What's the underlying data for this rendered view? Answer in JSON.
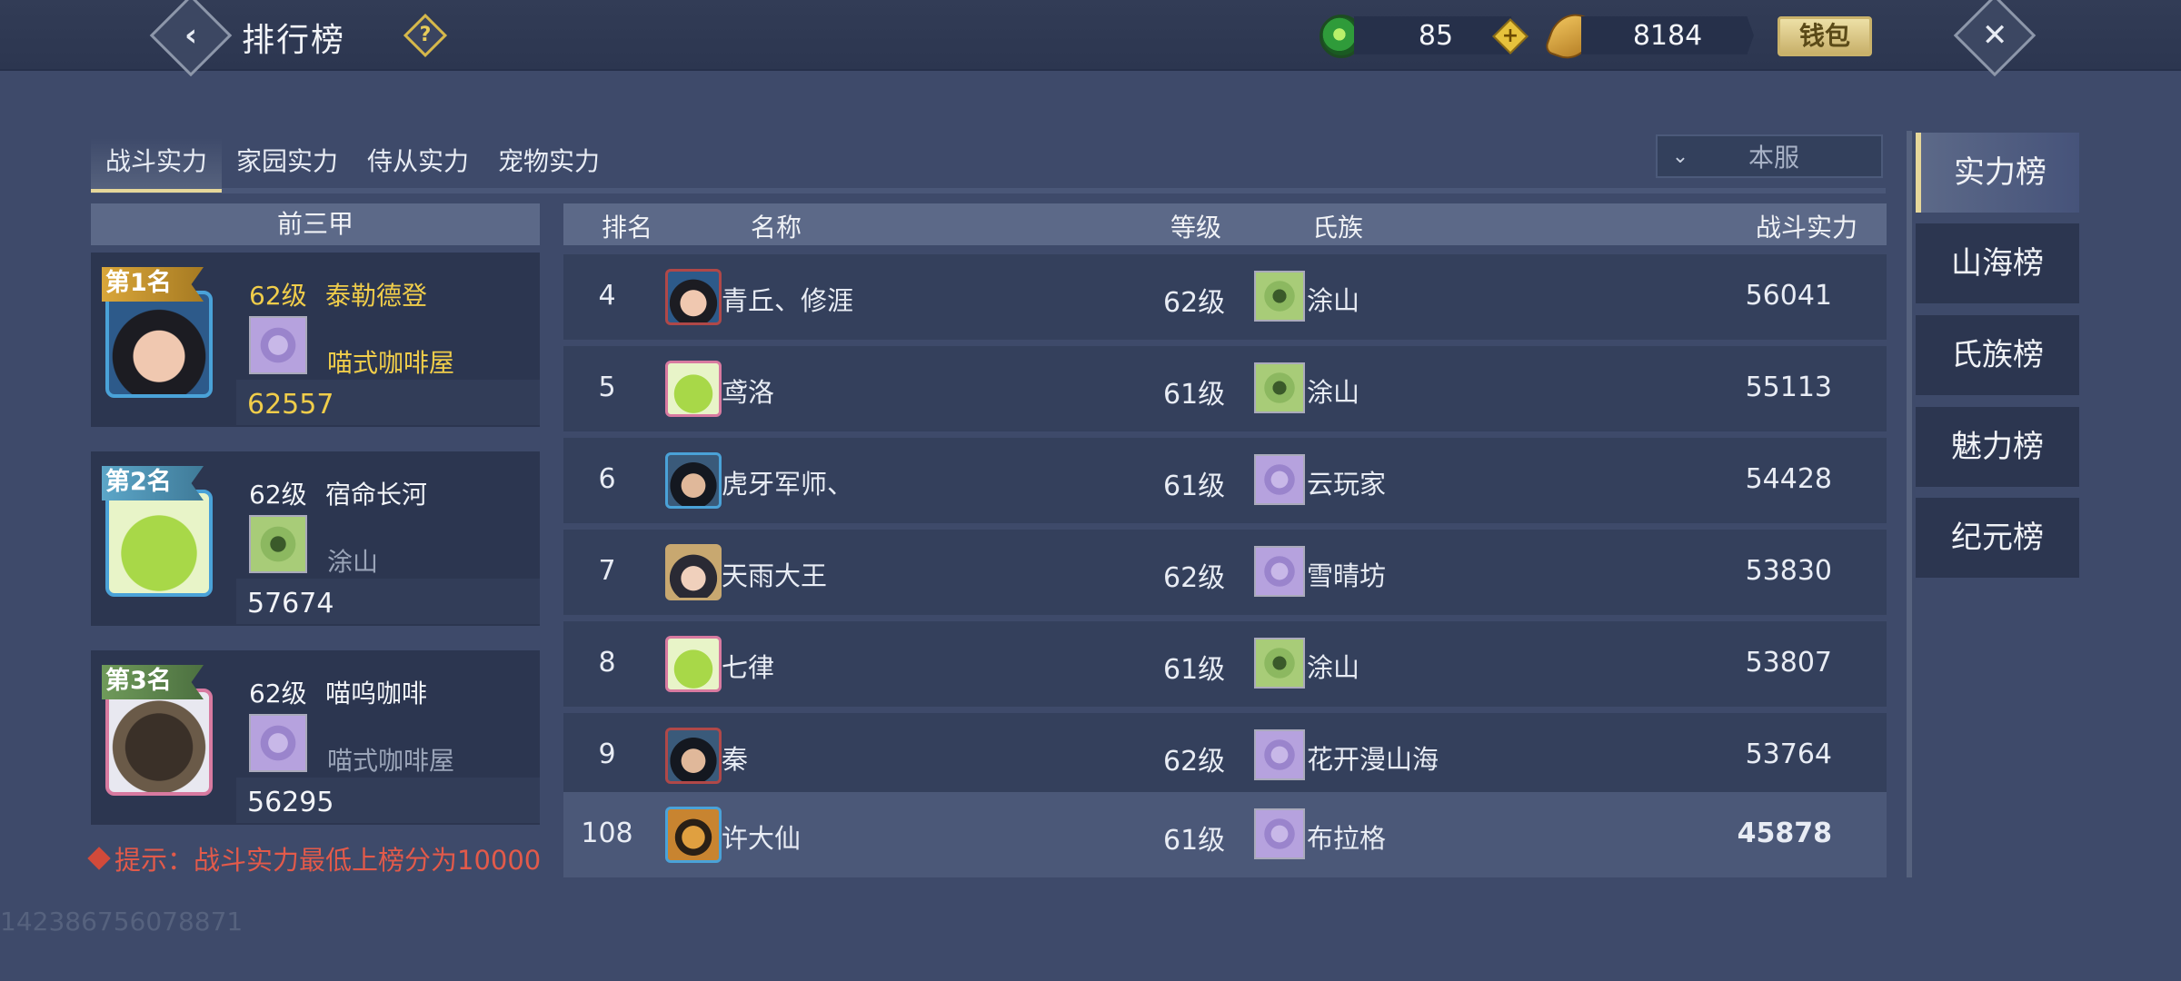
{
  "header": {
    "title": "排行榜",
    "jade_amount": "85",
    "gold_amount": "8184",
    "wallet_label": "钱包",
    "help_glyph": "?"
  },
  "category_tabs": [
    "战斗实力",
    "家园实力",
    "侍从实力",
    "宠物实力"
  ],
  "server_select": {
    "value": "本服"
  },
  "top3": {
    "header": "前三甲",
    "entries": [
      {
        "rank_label": "第1名",
        "level": "62级",
        "name": "泰勒德登",
        "clan": "喵式咖啡屋",
        "power": "62557"
      },
      {
        "rank_label": "第2名",
        "level": "62级",
        "name": "宿命长河",
        "clan": "涂山",
        "power": "57674"
      },
      {
        "rank_label": "第3名",
        "level": "62级",
        "name": "喵呜咖啡",
        "clan": "喵式咖啡屋",
        "power": "56295"
      }
    ]
  },
  "table": {
    "headers": {
      "rank": "排名",
      "name": "名称",
      "level": "等级",
      "clan": "氏族",
      "power": "战斗实力"
    },
    "rows": [
      {
        "rank": "4",
        "name": "青丘、修涯",
        "level": "62级",
        "clan": "涂山",
        "power": "56041"
      },
      {
        "rank": "5",
        "name": "鸢洛",
        "level": "61级",
        "clan": "涂山",
        "power": "55113"
      },
      {
        "rank": "6",
        "name": "虎牙军师、",
        "level": "61级",
        "clan": "云玩家",
        "power": "54428"
      },
      {
        "rank": "7",
        "name": "天雨大王",
        "level": "62级",
        "clan": "雪晴坊",
        "power": "53830"
      },
      {
        "rank": "8",
        "name": "七律",
        "level": "61级",
        "clan": "涂山",
        "power": "53807"
      },
      {
        "rank": "9",
        "name": "秦",
        "level": "62级",
        "clan": "花开漫山海",
        "power": "53764"
      }
    ],
    "self_row": {
      "rank": "108",
      "name": "许大仙",
      "level": "61级",
      "clan": "布拉格",
      "power": "45878"
    }
  },
  "tip": "提示：战斗实力最低上榜分为10000",
  "uid": "142386756078871",
  "side_tabs": [
    "实力榜",
    "山海榜",
    "氏族榜",
    "魅力榜",
    "纪元榜"
  ]
}
